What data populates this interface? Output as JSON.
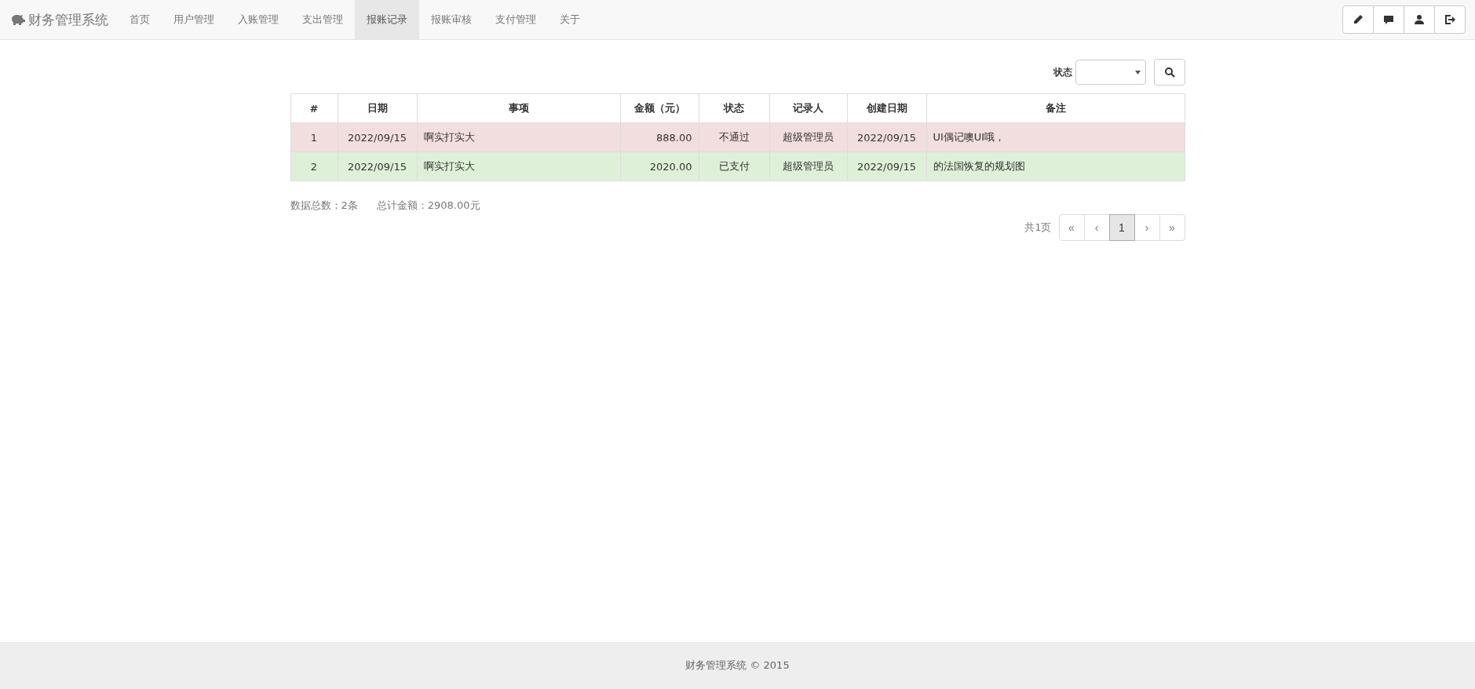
{
  "navbar": {
    "brand": "财务管理系统",
    "items": [
      {
        "label": "首页",
        "selected": false
      },
      {
        "label": "用户管理",
        "selected": false
      },
      {
        "label": "入账管理",
        "selected": false
      },
      {
        "label": "支出管理",
        "selected": false
      },
      {
        "label": "报账记录",
        "selected": true
      },
      {
        "label": "报账审核",
        "selected": false
      },
      {
        "label": "支付管理",
        "selected": false
      },
      {
        "label": "关于",
        "selected": false
      }
    ]
  },
  "filter": {
    "label": "状态"
  },
  "table": {
    "columns": [
      "#",
      "日期",
      "事项",
      "金额（元）",
      "状态",
      "记录人",
      "创建日期",
      "备注"
    ],
    "rows": [
      {
        "kind": "rejected",
        "cells": [
          "1",
          "2022/09/15",
          "啊实打实大",
          "888.00",
          "不通过",
          "超级管理员",
          "2022/09/15",
          "UI偶记噢UI哦，"
        ]
      },
      {
        "kind": "paid",
        "cells": [
          "2",
          "2022/09/15",
          "啊实打实大",
          "2020.00",
          "已支付",
          "超级管理员",
          "2022/09/15",
          "的法国恢复的规划图"
        ]
      }
    ]
  },
  "summary": {
    "count": "数据总数：2条",
    "total": "总计金额：2908.00元"
  },
  "pagination": {
    "info": "共1页",
    "pages": [
      {
        "label": "«",
        "selected": false
      },
      {
        "label": "‹",
        "selected": false
      },
      {
        "label": "1",
        "selected": true
      },
      {
        "label": "›",
        "selected": false
      },
      {
        "label": "»",
        "selected": false
      }
    ]
  },
  "footer": "财务管理系统 © 2015"
}
